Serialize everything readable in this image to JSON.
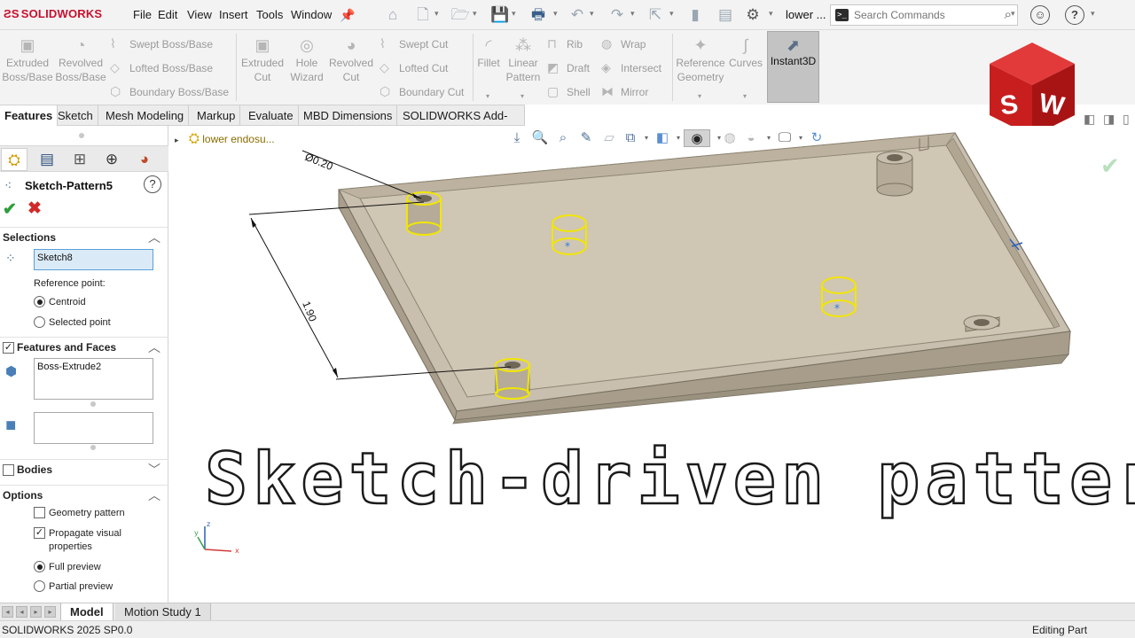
{
  "app": {
    "logo_text": "SOLIDWORKS",
    "doc_title": "lower ...",
    "status_left": "SOLIDWORKS 2025 SP0.0",
    "status_right": "Editing Part",
    "brand_red": "#c8102e"
  },
  "menu": [
    "File",
    "Edit",
    "View",
    "Insert",
    "Tools",
    "Window"
  ],
  "search": {
    "placeholder": "Search Commands"
  },
  "command_manager": {
    "boss": {
      "extruded": "Extruded Boss/Base",
      "revolved": "Revolved Boss/Base",
      "swept": "Swept Boss/Base",
      "lofted": "Lofted Boss/Base",
      "boundary": "Boundary Boss/Base"
    },
    "cut": {
      "extruded": "Extruded Cut",
      "hole": "Hole Wizard",
      "revolved": "Revolved Cut",
      "swept": "Swept Cut",
      "lofted": "Lofted Cut",
      "boundary": "Boundary Cut"
    },
    "features": {
      "fillet": "Fillet",
      "linear_pattern": "Linear Pattern",
      "rib": "Rib",
      "draft": "Draft",
      "shell": "Shell",
      "wrap": "Wrap",
      "intersect": "Intersect",
      "mirror": "Mirror"
    },
    "ref_geometry": "Reference Geometry",
    "curves": "Curves",
    "instant3d": "Instant3D"
  },
  "tabs": [
    "Features",
    "Sketch",
    "Mesh Modeling",
    "Markup",
    "Evaluate",
    "MBD Dimensions",
    "SOLIDWORKS Add-Ins"
  ],
  "property_manager": {
    "title": "Sketch-Pattern5",
    "help": "?",
    "selections_header": "Selections",
    "sketch_value": "Sketch8",
    "reference_point_label": "Reference point:",
    "ref_options": [
      "Centroid",
      "Selected point"
    ],
    "ref_selected": "Centroid",
    "features_faces_header": "Features and Faces",
    "features_value": "Boss-Extrude2",
    "faces_value": "",
    "bodies_header": "Bodies",
    "options_header": "Options",
    "geometry_pattern": "Geometry pattern",
    "propagate_visual": "Propagate visual properties",
    "full_preview": "Full preview",
    "partial_preview": "Partial preview",
    "preview_selected": "Full preview"
  },
  "viewport": {
    "tree_label": "lower endosu...",
    "dim_diameter": "Ø0.20",
    "dim_length": "1.90",
    "overlay_text": "Sketch-driven patterns",
    "axis_x": "x",
    "axis_y": "y",
    "axis_z": "z"
  },
  "bottom_tabs": [
    "Model",
    "Motion Study 1"
  ],
  "colors": {
    "part_body": "#c9bfae",
    "part_rim": "#bdb29f",
    "part_side": "#a89e8b",
    "sketch_yellow": "#f2e600",
    "sketch_point": "#2f7be0"
  }
}
